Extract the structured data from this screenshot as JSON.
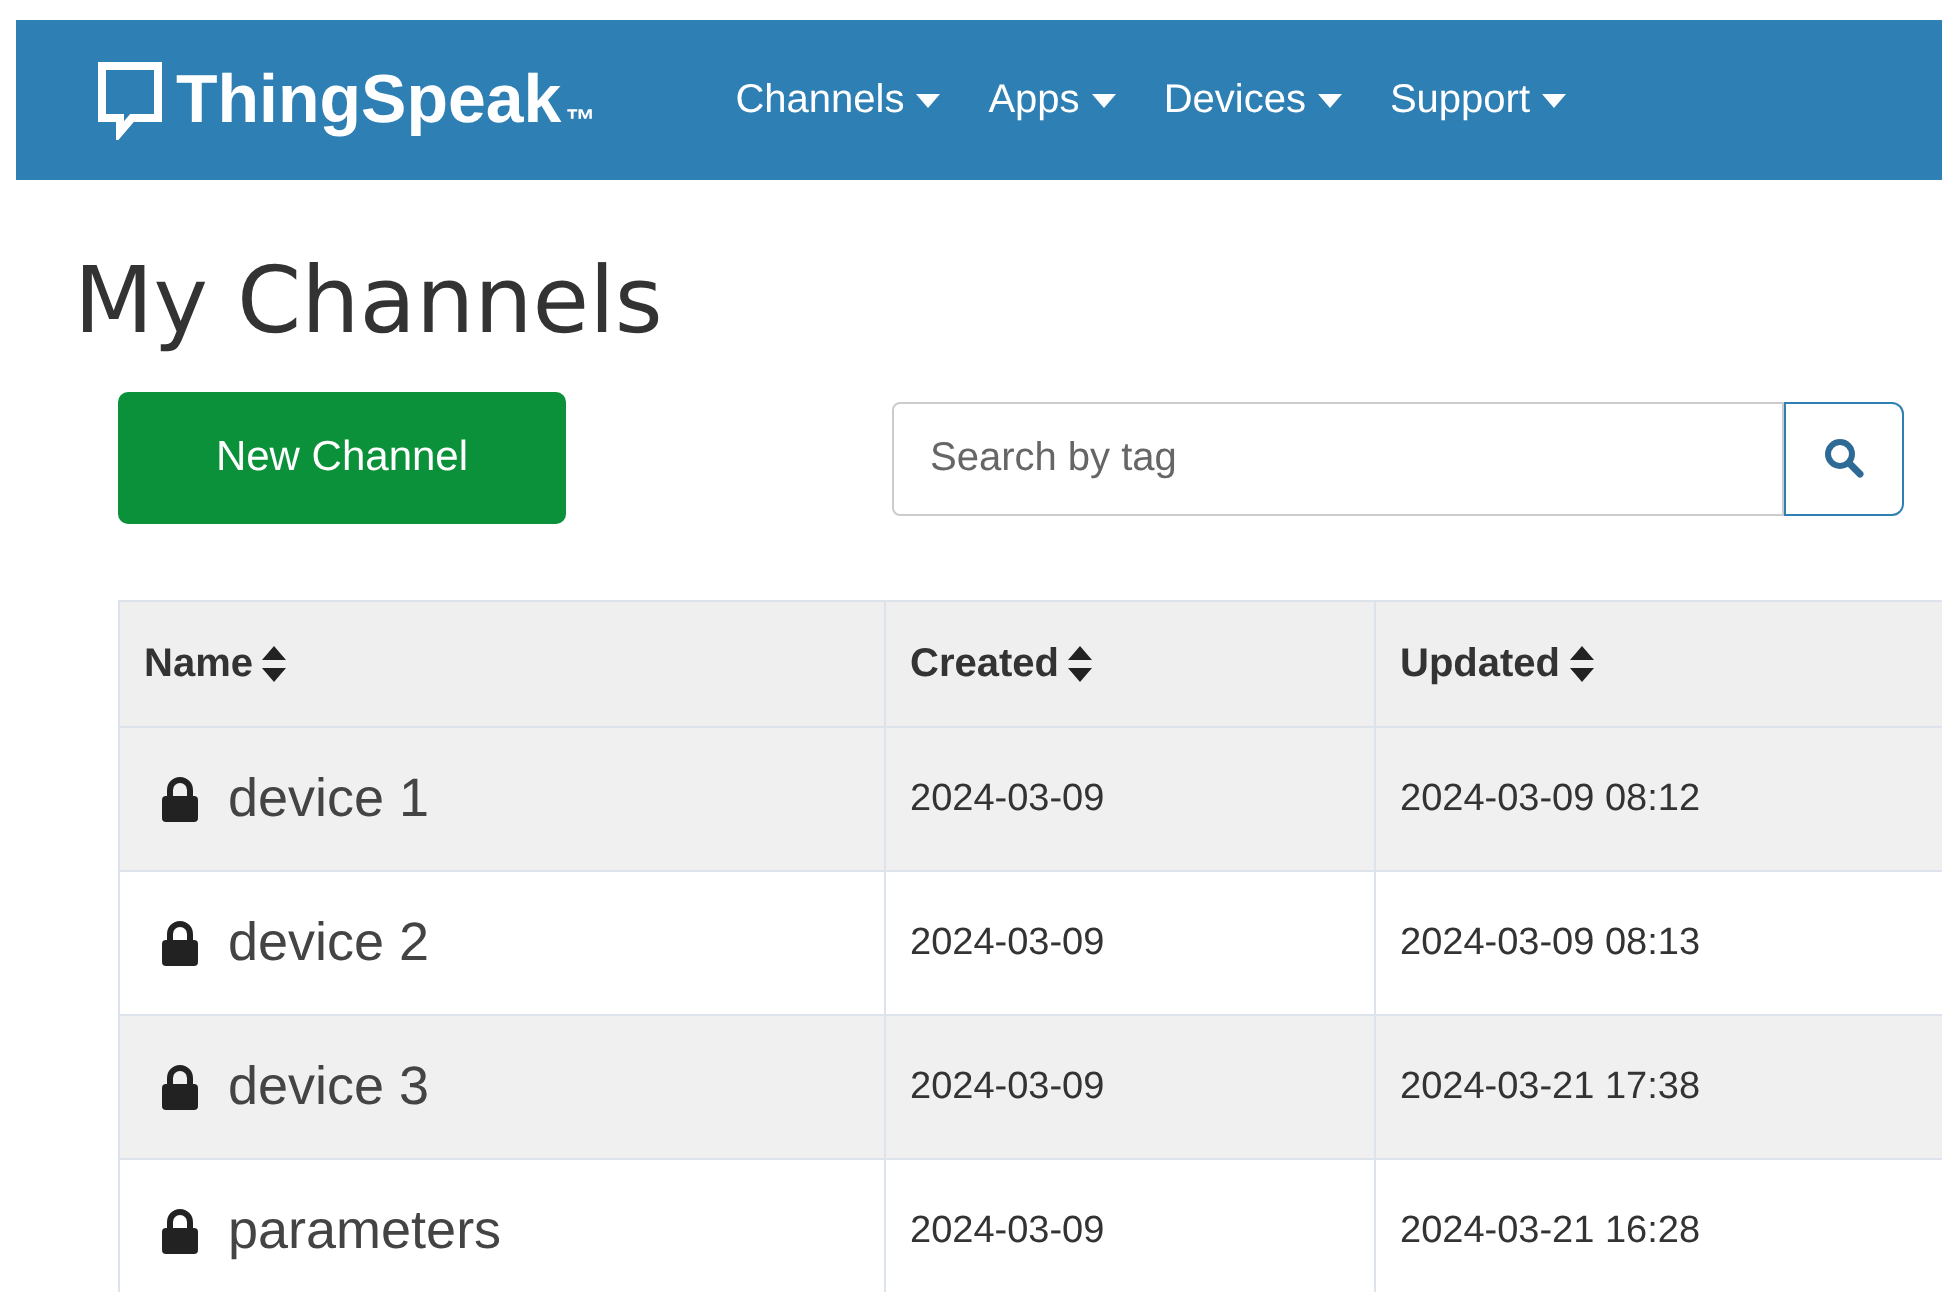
{
  "navbar": {
    "brand": "ThingSpeak",
    "trademark": "™",
    "menus": [
      {
        "label": "Channels"
      },
      {
        "label": "Apps"
      },
      {
        "label": "Devices"
      },
      {
        "label": "Support"
      }
    ]
  },
  "page_title": "My Channels",
  "new_button": "New Channel",
  "search": {
    "placeholder": "Search by tag"
  },
  "table": {
    "columns": [
      "Name",
      "Created",
      "Updated"
    ],
    "rows": [
      {
        "private": true,
        "name": "device 1",
        "created": "2024-03-09",
        "updated": "2024-03-09 08:12"
      },
      {
        "private": true,
        "name": "device 2",
        "created": "2024-03-09",
        "updated": "2024-03-09 08:13"
      },
      {
        "private": true,
        "name": "device 3",
        "created": "2024-03-09",
        "updated": "2024-03-21 17:38"
      },
      {
        "private": true,
        "name": "parameters",
        "created": "2024-03-09",
        "updated": "2024-03-21 16:28"
      }
    ]
  }
}
